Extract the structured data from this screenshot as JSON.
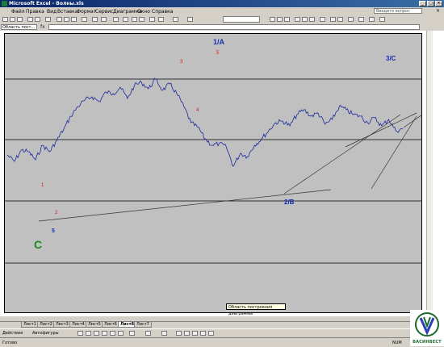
{
  "window": {
    "title": "Microsoft Excel - Волны.xls"
  },
  "menu": [
    "Файл",
    "Правка",
    "Вид",
    "Вставка",
    "Формат",
    "Сервис",
    "Диаграмма",
    "Окно",
    "Справка"
  ],
  "ask_placeholder": "Введите вопрос",
  "name_box": "Область пост...",
  "fx": "fx",
  "tabs": [
    "Лист1",
    "Лист2",
    "Лист3",
    "Лист4",
    "Лист5",
    "Лист6",
    "Лист8",
    "Лист7"
  ],
  "active_tab": "Лист8",
  "draw_actions": "Действия",
  "autoshapes": "Автофигуры",
  "status": "Готово",
  "status_right": "NUM",
  "tooltip": "Область построения диаграммы",
  "logo_text": "ВАСИНВЕСТ",
  "colors": {
    "wave_label_blue": "#1a2fb0",
    "wave_label_red": "#e01010",
    "wave_label_green": "#1a8a1a",
    "price_line": "#1b2a9a"
  },
  "chart_data": {
    "type": "line",
    "title": "",
    "xlabel": "",
    "ylabel": "",
    "grid": true,
    "series": [
      {
        "values": [
          100,
          92,
          106,
          104,
          94,
          112,
          104,
          118,
          132,
          148,
          160,
          168,
          172,
          166,
          178,
          176,
          184,
          170,
          186,
          190,
          182,
          194,
          180,
          188,
          176,
          160,
          140,
          134,
          120,
          112,
          114,
          110,
          86,
          102,
          98,
          112,
          120,
          130,
          140,
          142,
          136,
          150,
          156,
          148,
          152,
          138,
          144,
          160,
          156,
          150,
          148,
          140,
          146,
          136,
          144,
          130,
          132
        ]
      }
    ],
    "annotations": [
      "1",
      "2",
      "3",
      "4",
      "5",
      "1/A",
      "2/B",
      "3/C",
      "5",
      "C"
    ]
  }
}
